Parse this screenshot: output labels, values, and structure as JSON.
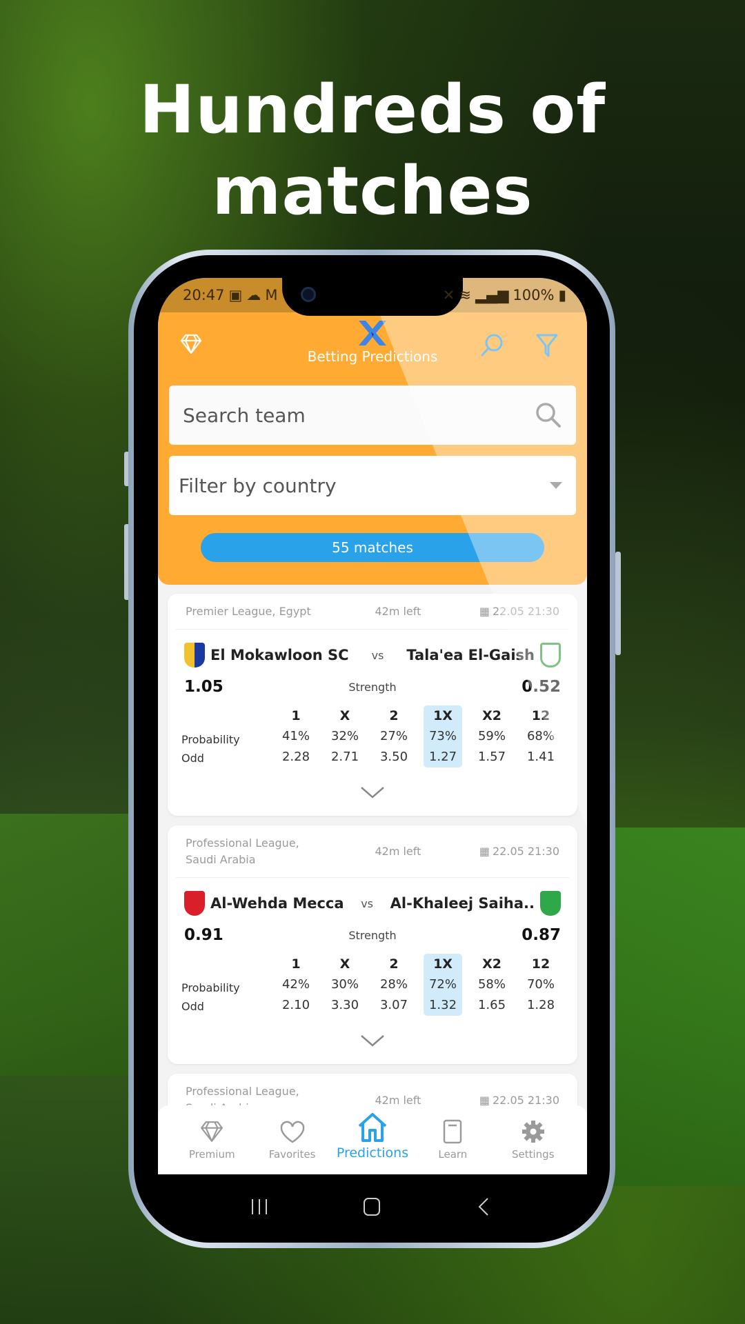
{
  "headline": [
    "Hundreds of",
    "matches"
  ],
  "status_bar": {
    "time": "20:47",
    "battery": "100%"
  },
  "app_bar": {
    "title": "Betting Predictions",
    "icons": [
      "diamond-icon",
      "app-logo-x",
      "search-icon",
      "filter-icon"
    ]
  },
  "search": {
    "placeholder": "Search team"
  },
  "country_filter": {
    "placeholder": "Filter by country"
  },
  "matches_count": "55 matches",
  "accent_colors": {
    "orange": "#ffab33",
    "blue": "#2aa2ea",
    "highlight": "#d2ebfb"
  },
  "table_labels": {
    "probability": "Probability",
    "odd": "Odd",
    "strength": "Strength",
    "vs": "vs"
  },
  "bet_columns": [
    "1",
    "X",
    "2",
    "1X",
    "X2",
    "12"
  ],
  "matches": [
    {
      "league": "Premier League, Egypt",
      "time_left": "42m left",
      "date": "22.05 21:30",
      "home": {
        "name": "El Mokawloon SC",
        "strength": "1.05"
      },
      "away": {
        "name": "Tala'ea El-Gaish",
        "strength": "0.52"
      },
      "probabilities": [
        "41%",
        "32%",
        "27%",
        "73%",
        "59%",
        "68%"
      ],
      "odds": [
        "2.28",
        "2.71",
        "3.50",
        "1.27",
        "1.57",
        "1.41"
      ],
      "highlighted": "1X"
    },
    {
      "league": "Professional League, Saudi Arabia",
      "time_left": "42m left",
      "date": "22.05 21:30",
      "home": {
        "name": "Al-Wehda Mecca",
        "strength": "0.91"
      },
      "away": {
        "name": "Al-Khaleej Saiha..",
        "strength": "0.87"
      },
      "probabilities": [
        "42%",
        "30%",
        "28%",
        "72%",
        "58%",
        "70%"
      ],
      "odds": [
        "2.10",
        "3.30",
        "3.07",
        "1.32",
        "1.65",
        "1.28"
      ],
      "highlighted": "1X"
    },
    {
      "league": "Professional League, Saudi Arabia",
      "time_left": "42m left",
      "date": "22.05 21:30"
    }
  ],
  "bottom_nav": [
    {
      "label": "Premium",
      "icon": "diamond-icon",
      "active": false
    },
    {
      "label": "Favorites",
      "icon": "heart-icon",
      "active": false
    },
    {
      "label": "Predictions",
      "icon": "home-icon",
      "active": true
    },
    {
      "label": "Learn",
      "icon": "book-icon",
      "active": false
    },
    {
      "label": "Settings",
      "icon": "gear-icon",
      "active": false
    }
  ]
}
